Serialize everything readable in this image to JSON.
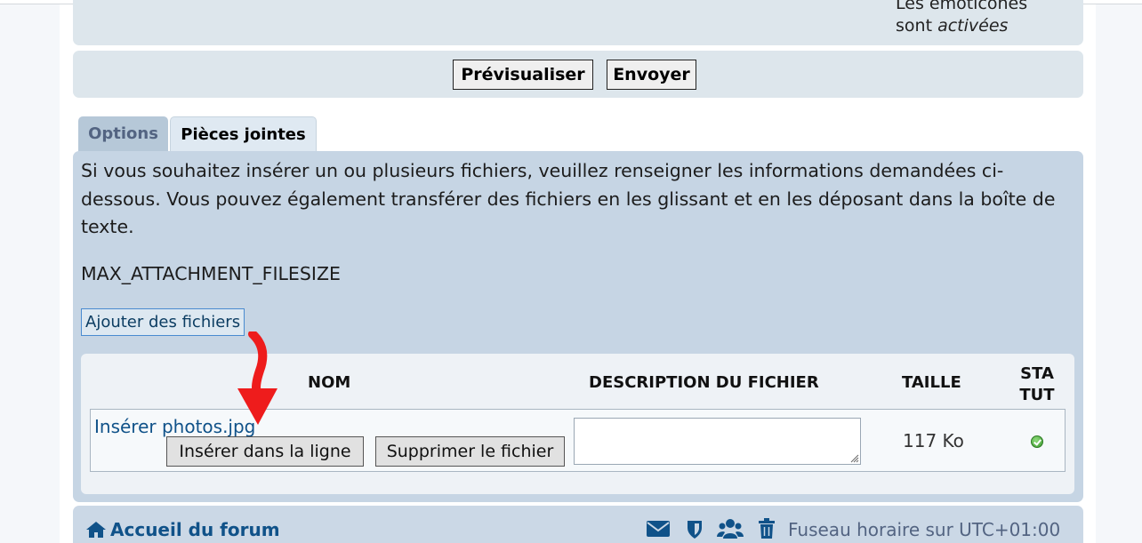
{
  "smilies": {
    "line1": "Les émoticônes",
    "line2_prefix": "sont ",
    "line2_state": "activées"
  },
  "submit": {
    "preview_label": "Prévisualiser",
    "send_label": "Envoyer"
  },
  "tabs": [
    {
      "label": "Options",
      "active": false
    },
    {
      "label": "Pièces jointes",
      "active": true
    }
  ],
  "attachments": {
    "intro": "Si vous souhaitez insérer un ou plusieurs fichiers, veuillez renseigner les informations demandées ci-dessous. Vous pouvez également transférer des fichiers en les glissant et en les déposant dans la boîte de texte.",
    "max_size": "MAX_ATTACHMENT_FILESIZE",
    "add_files_label": "Ajouter des fichiers",
    "columns": {
      "name": "NOM",
      "description": "DESCRIPTION DU FICHIER",
      "size": "TAILLE",
      "status_line1": "STA",
      "status_line2": "TUT"
    },
    "files": [
      {
        "name": "Insérer photos.jpg",
        "insert_inline_label": "Insérer dans la ligne",
        "delete_label": "Supprimer le fichier",
        "description": "",
        "size": "117 Ko",
        "status": "ok"
      }
    ]
  },
  "footer": {
    "home_label": "Accueil du forum",
    "icons": [
      "envelope-icon",
      "shield-icon",
      "users-icon",
      "trash-icon"
    ],
    "timezone": "Fuseau horaire sur UTC+01:00"
  },
  "colors": {
    "link": "#105289",
    "panel": "#c6d5e4",
    "annotation_arrow": "#ee1c1c"
  }
}
